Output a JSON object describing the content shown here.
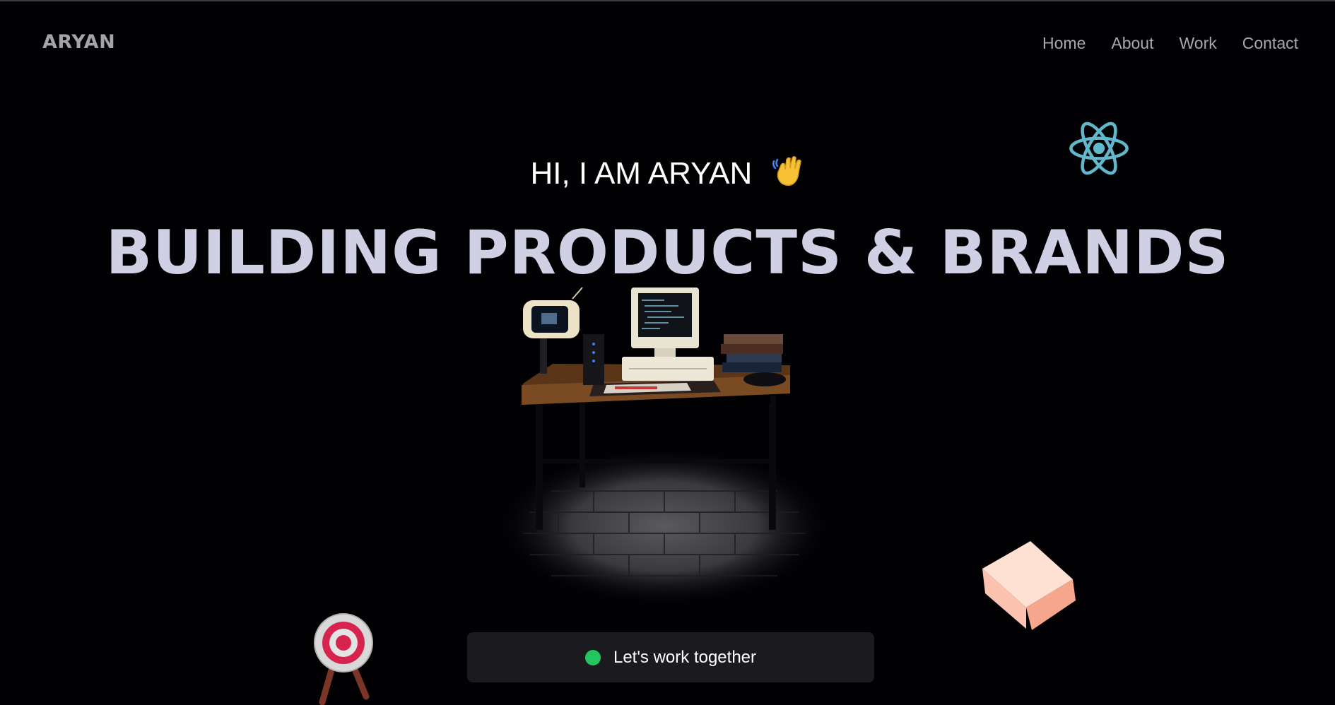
{
  "navbar": {
    "logo": "ARYAN",
    "links": [
      {
        "label": "Home"
      },
      {
        "label": "About"
      },
      {
        "label": "Work"
      },
      {
        "label": "Contact"
      }
    ]
  },
  "hero": {
    "greeting": "HI, I AM ARYAN",
    "greeting_icon": "waving-hand-icon",
    "title": "BUILDING PRODUCTS & BRANDS"
  },
  "cta": {
    "label": "Let's work together",
    "status_color": "#22c55e"
  },
  "decor": {
    "icons": [
      "react-logo-icon",
      "pink-cube-icon",
      "target-icon",
      "desk-computer-scene"
    ]
  },
  "colors": {
    "background": "#010103",
    "title": "#cfd0e4",
    "nav_text": "#a8a8ac",
    "react_blue": "#61b8cc",
    "cta_background": "#1b1b1f"
  }
}
